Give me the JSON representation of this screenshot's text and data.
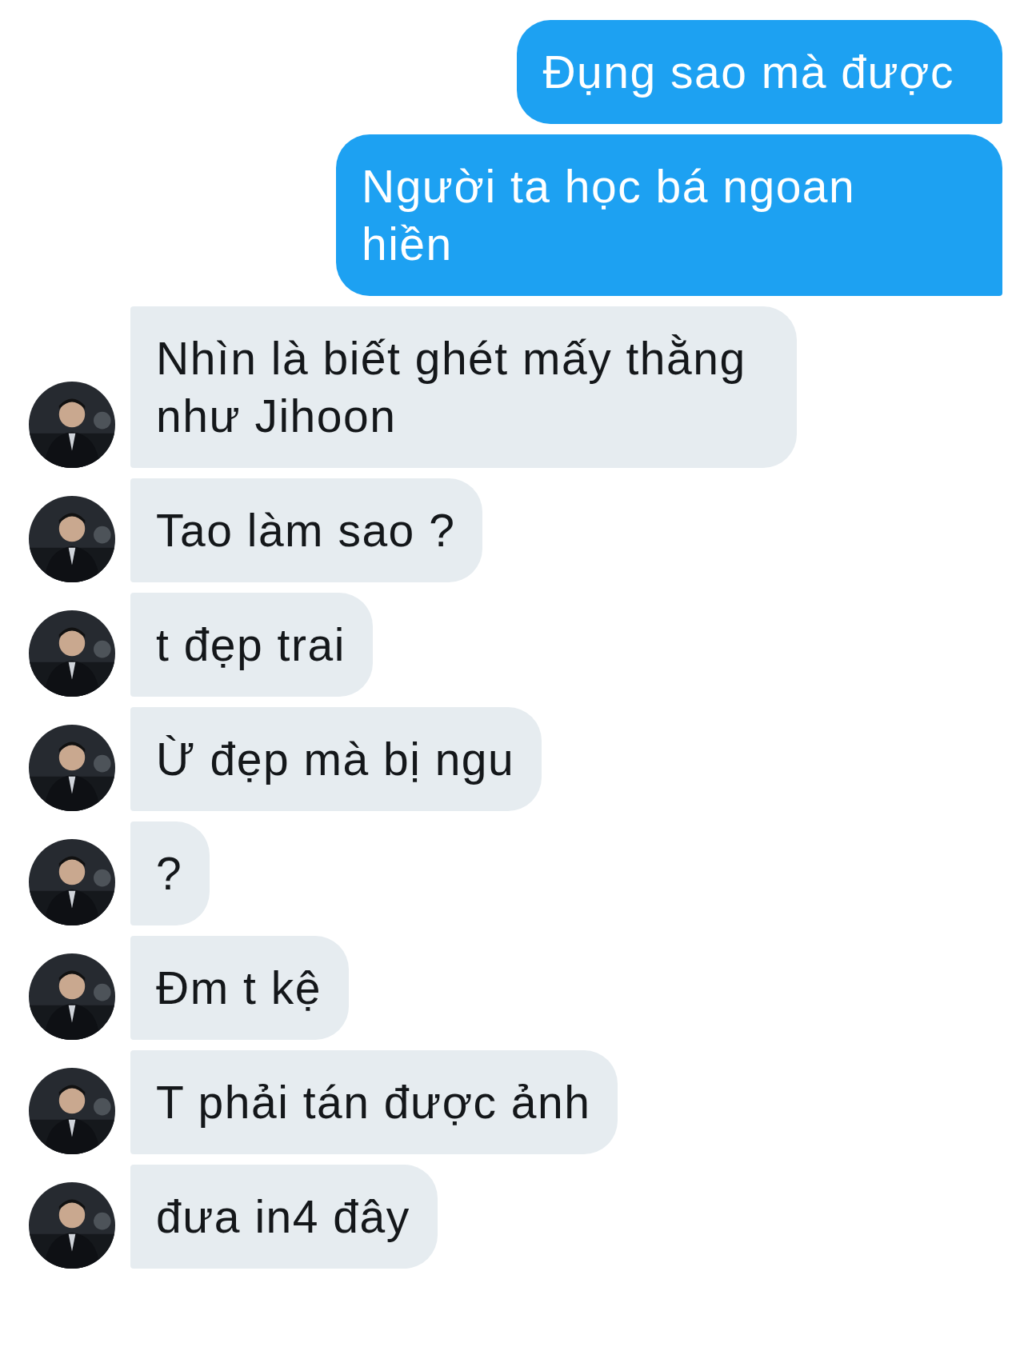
{
  "messages": [
    {
      "kind": "sent",
      "text": "Đụng sao mà được"
    },
    {
      "kind": "sent",
      "text": "Người ta học bá ngoan hiền"
    },
    {
      "kind": "received",
      "text": "Nhìn là biết ghét mấy thằng như Jihoon"
    },
    {
      "kind": "received",
      "text": "Tao làm sao ?"
    },
    {
      "kind": "received",
      "text": "t đẹp trai"
    },
    {
      "kind": "received",
      "text": "Ừ đẹp mà bị ngu"
    },
    {
      "kind": "received",
      "text": "?"
    },
    {
      "kind": "received",
      "text": "Đm t kệ"
    },
    {
      "kind": "received",
      "text": "T phải tán được ảnh"
    },
    {
      "kind": "received",
      "text": "đưa in4 đây"
    }
  ]
}
